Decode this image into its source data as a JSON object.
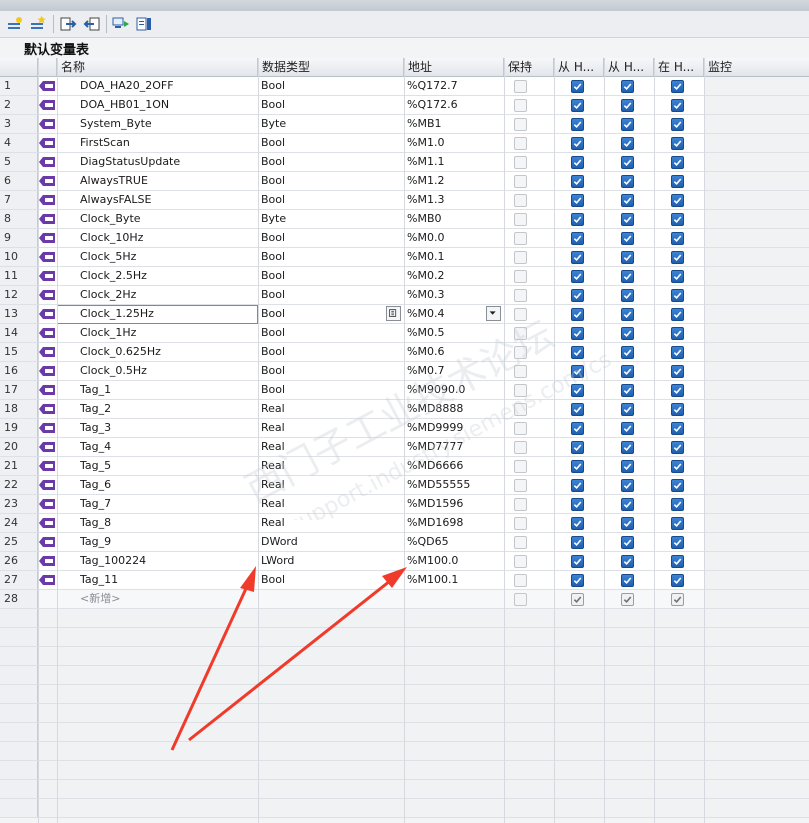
{
  "table": {
    "title": "默认变量表",
    "columns": {
      "name": "名称",
      "datatype": "数据类型",
      "address": "地址",
      "retain": "保持",
      "access": "从 H...",
      "write": "从 H...",
      "visible": "在 H...",
      "monitor": "监控"
    },
    "rows": [
      {
        "num": "1",
        "name": "DOA_HA20_2OFF",
        "type": "Bool",
        "addr": "%Q172.7",
        "retain": false,
        "c1": true,
        "c2": true,
        "c3": true
      },
      {
        "num": "2",
        "name": "DOA_HB01_1ON",
        "type": "Bool",
        "addr": "%Q172.6",
        "retain": false,
        "c1": true,
        "c2": true,
        "c3": true
      },
      {
        "num": "3",
        "name": "System_Byte",
        "type": "Byte",
        "addr": "%MB1",
        "retain": false,
        "c1": true,
        "c2": true,
        "c3": true
      },
      {
        "num": "4",
        "name": "FirstScan",
        "type": "Bool",
        "addr": "%M1.0",
        "retain": false,
        "c1": true,
        "c2": true,
        "c3": true
      },
      {
        "num": "5",
        "name": "DiagStatusUpdate",
        "type": "Bool",
        "addr": "%M1.1",
        "retain": false,
        "c1": true,
        "c2": true,
        "c3": true
      },
      {
        "num": "6",
        "name": "AlwaysTRUE",
        "type": "Bool",
        "addr": "%M1.2",
        "retain": false,
        "c1": true,
        "c2": true,
        "c3": true
      },
      {
        "num": "7",
        "name": "AlwaysFALSE",
        "type": "Bool",
        "addr": "%M1.3",
        "retain": false,
        "c1": true,
        "c2": true,
        "c3": true
      },
      {
        "num": "8",
        "name": "Clock_Byte",
        "type": "Byte",
        "addr": "%MB0",
        "retain": false,
        "c1": true,
        "c2": true,
        "c3": true
      },
      {
        "num": "9",
        "name": "Clock_10Hz",
        "type": "Bool",
        "addr": "%M0.0",
        "retain": false,
        "c1": true,
        "c2": true,
        "c3": true
      },
      {
        "num": "10",
        "name": "Clock_5Hz",
        "type": "Bool",
        "addr": "%M0.1",
        "retain": false,
        "c1": true,
        "c2": true,
        "c3": true
      },
      {
        "num": "11",
        "name": "Clock_2.5Hz",
        "type": "Bool",
        "addr": "%M0.2",
        "retain": false,
        "c1": true,
        "c2": true,
        "c3": true
      },
      {
        "num": "12",
        "name": "Clock_2Hz",
        "type": "Bool",
        "addr": "%M0.3",
        "retain": false,
        "c1": true,
        "c2": true,
        "c3": true
      },
      {
        "num": "13",
        "name": "Clock_1.25Hz",
        "type": "Bool",
        "addr": "%M0.4",
        "retain": false,
        "c1": true,
        "c2": true,
        "c3": true,
        "selected": true
      },
      {
        "num": "14",
        "name": "Clock_1Hz",
        "type": "Bool",
        "addr": "%M0.5",
        "retain": false,
        "c1": true,
        "c2": true,
        "c3": true
      },
      {
        "num": "15",
        "name": "Clock_0.625Hz",
        "type": "Bool",
        "addr": "%M0.6",
        "retain": false,
        "c1": true,
        "c2": true,
        "c3": true
      },
      {
        "num": "16",
        "name": "Clock_0.5Hz",
        "type": "Bool",
        "addr": "%M0.7",
        "retain": false,
        "c1": true,
        "c2": true,
        "c3": true
      },
      {
        "num": "17",
        "name": "Tag_1",
        "type": "Bool",
        "addr": "%M9090.0",
        "retain": false,
        "c1": true,
        "c2": true,
        "c3": true
      },
      {
        "num": "18",
        "name": "Tag_2",
        "type": "Real",
        "addr": "%MD8888",
        "retain": false,
        "c1": true,
        "c2": true,
        "c3": true
      },
      {
        "num": "19",
        "name": "Tag_3",
        "type": "Real",
        "addr": "%MD9999",
        "retain": false,
        "c1": true,
        "c2": true,
        "c3": true
      },
      {
        "num": "20",
        "name": "Tag_4",
        "type": "Real",
        "addr": "%MD7777",
        "retain": false,
        "c1": true,
        "c2": true,
        "c3": true
      },
      {
        "num": "21",
        "name": "Tag_5",
        "type": "Real",
        "addr": "%MD6666",
        "retain": false,
        "c1": true,
        "c2": true,
        "c3": true
      },
      {
        "num": "22",
        "name": "Tag_6",
        "type": "Real",
        "addr": "%MD55555",
        "retain": false,
        "c1": true,
        "c2": true,
        "c3": true
      },
      {
        "num": "23",
        "name": "Tag_7",
        "type": "Real",
        "addr": "%MD1596",
        "retain": false,
        "c1": true,
        "c2": true,
        "c3": true
      },
      {
        "num": "24",
        "name": "Tag_8",
        "type": "Real",
        "addr": "%MD1698",
        "retain": false,
        "c1": true,
        "c2": true,
        "c3": true
      },
      {
        "num": "25",
        "name": "Tag_9",
        "type": "DWord",
        "addr": "%QD65",
        "retain": false,
        "c1": true,
        "c2": true,
        "c3": true
      },
      {
        "num": "26",
        "name": "Tag_100224",
        "type": "LWord",
        "addr": "%M100.0",
        "retain": false,
        "c1": true,
        "c2": true,
        "c3": true
      },
      {
        "num": "27",
        "name": "Tag_11",
        "type": "Bool",
        "addr": "%M100.1",
        "retain": false,
        "c1": true,
        "c2": true,
        "c3": true
      }
    ],
    "new_row": {
      "num": "28",
      "label": "<新增>"
    },
    "empty_row_count": 11
  },
  "watermark": {
    "line1": "西门子工业技术论坛",
    "line2": "support.industry.siemens.com/cs"
  },
  "colors": {
    "checkbox_on": "#2a6fc3",
    "tag_icon": "#6b3aa8",
    "annotation_arrow": "#f03a2a",
    "selection_border": "#5b8fd0"
  },
  "toolbar": {
    "icons": [
      "add-tag-icon",
      "insert-row-icon",
      "export-icon",
      "import-icon",
      "monitor-icon",
      "settings-icon"
    ]
  }
}
